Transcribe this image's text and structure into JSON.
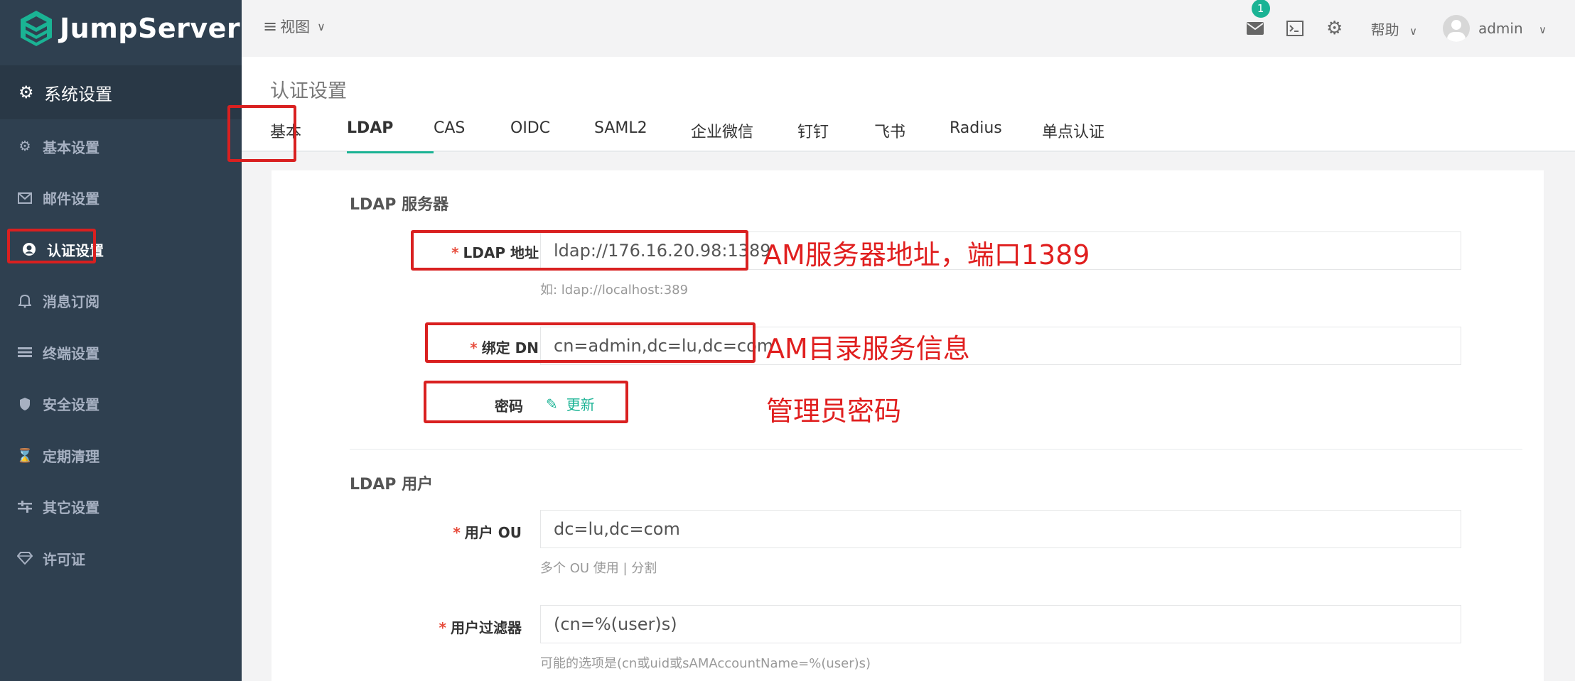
{
  "brand": {
    "name": "JumpServer",
    "color": "#1ab394"
  },
  "sidebar": {
    "section": {
      "icon": "gear-icon",
      "label": "系统设置"
    },
    "items": [
      {
        "icon": "gear-icon",
        "label": "基本设置",
        "active": false
      },
      {
        "icon": "envelope-icon",
        "label": "邮件设置",
        "active": false
      },
      {
        "icon": "user-circle-icon",
        "label": "认证设置",
        "active": true
      },
      {
        "icon": "bell-icon",
        "label": "消息订阅",
        "active": false
      },
      {
        "icon": "terminal-list-icon",
        "label": "终端设置",
        "active": false
      },
      {
        "icon": "shield-icon",
        "label": "安全设置",
        "active": false
      },
      {
        "icon": "hourglass-icon",
        "label": "定期清理",
        "active": false
      },
      {
        "icon": "sliders-icon",
        "label": "其它设置",
        "active": false
      },
      {
        "icon": "diamond-icon",
        "label": "许可证",
        "active": false
      }
    ]
  },
  "topbar": {
    "view_label": "视图",
    "notification_count": "1",
    "help_label": "帮助",
    "username": "admin"
  },
  "page": {
    "title": "认证设置",
    "tabs": [
      "基本",
      "LDAP",
      "CAS",
      "OIDC",
      "SAML2",
      "企业微信",
      "钉钉",
      "飞书",
      "Radius",
      "单点认证"
    ],
    "active_tab": "LDAP"
  },
  "form": {
    "server_section": "LDAP 服务器",
    "ldap_address": {
      "label": "LDAP 地址",
      "value": "ldap://176.16.20.98:1389",
      "hint": "如: ldap://localhost:389"
    },
    "bind_dn": {
      "label": "绑定 DN",
      "value": "cn=admin,dc=lu,dc=com"
    },
    "password": {
      "label": "密码",
      "link": "更新"
    },
    "user_section": "LDAP 用户",
    "user_ou": {
      "label": "用户 OU",
      "value": "dc=lu,dc=com",
      "hint": "多个 OU 使用 | 分割"
    },
    "user_filter": {
      "label": "用户过滤器",
      "value": "(cn=%(user)s)",
      "hint": "可能的选项是(cn或uid或sAMAccountName=%(user)s)"
    }
  },
  "annotations": {
    "address_note": "AM服务器地址，端口1389",
    "dn_note": "AM目录服务信息",
    "password_note": "管理员密码",
    "color": "#d92020"
  }
}
